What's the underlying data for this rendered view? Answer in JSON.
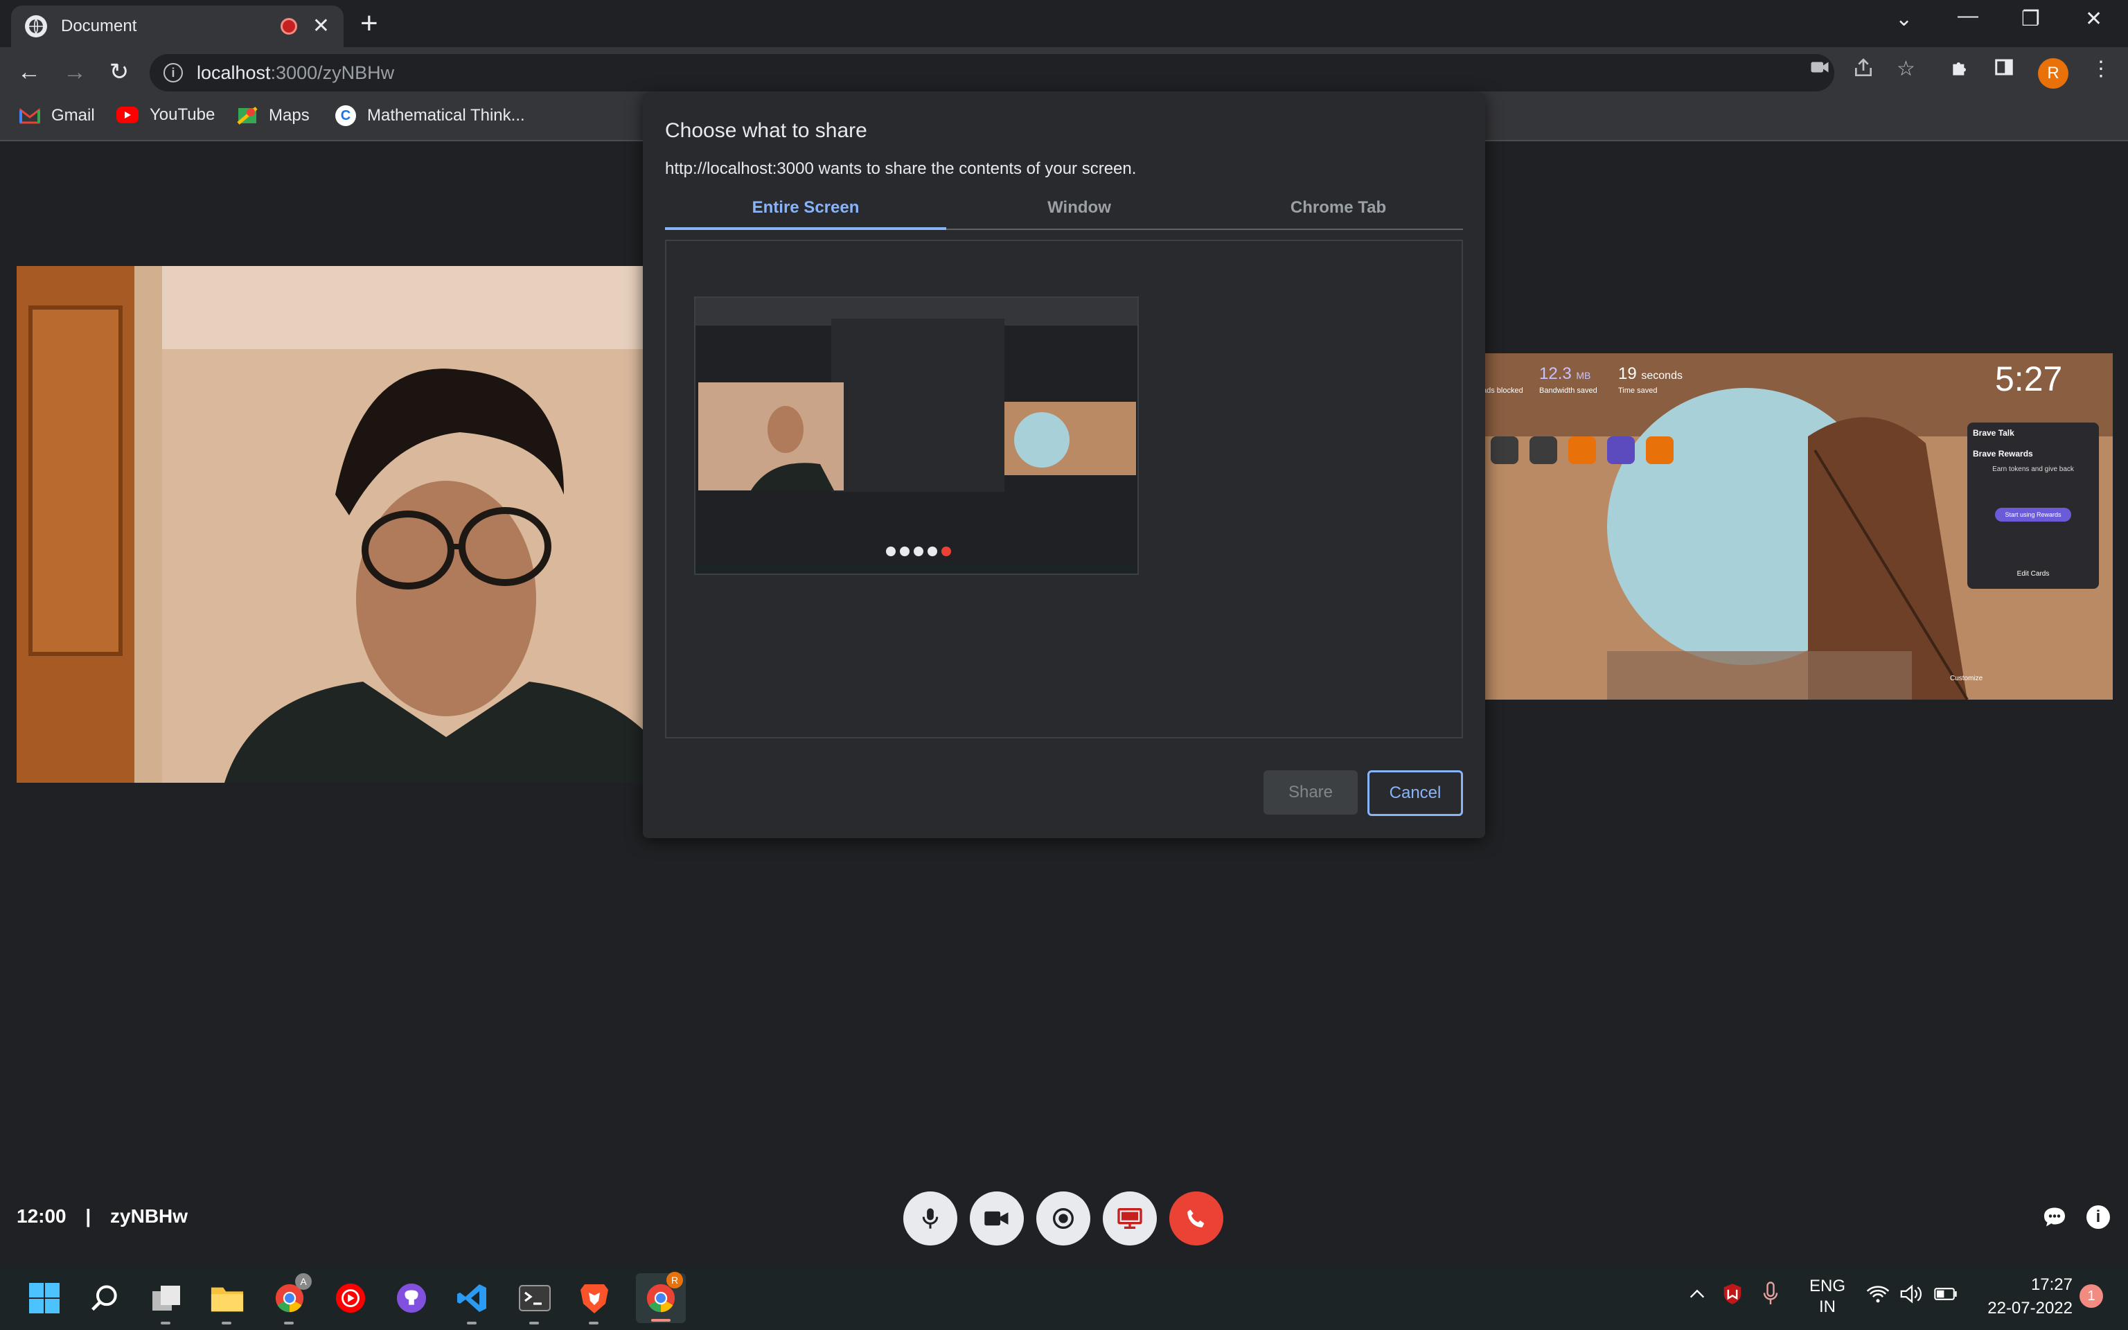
{
  "browser": {
    "tab_title": "Document",
    "url_host": "localhost",
    "url_path": ":3000/zyNBHw",
    "avatar_letter": "R",
    "bookmarks": [
      {
        "label": "Gmail",
        "color": "#ea4335"
      },
      {
        "label": "YouTube",
        "color": "#ff0000"
      },
      {
        "label": "Maps",
        "color": "#34a853"
      },
      {
        "label": "Mathematical Think...",
        "color": "#1a73e8"
      }
    ]
  },
  "dialog": {
    "title": "Choose what to share",
    "subtitle": "http://localhost:3000 wants to share the contents of your screen.",
    "tabs": [
      "Entire Screen",
      "Window",
      "Chrome Tab"
    ],
    "active_tab": "Entire Screen",
    "share_label": "Share",
    "cancel_label": "Cancel"
  },
  "remote_screen": {
    "ads_blocked_label": "ads blocked",
    "bandwidth_value": "12.3",
    "bandwidth_unit": "MB",
    "bandwidth_label": "Bandwidth saved",
    "time_value": "19",
    "time_unit": "seconds",
    "time_label": "Time saved",
    "clock": "5:27",
    "card_header": "Brave Talk",
    "card_title": "Brave Rewards",
    "card_sub": "Earn tokens and give back",
    "card_button": "Start using Rewards",
    "edit_cards": "Edit Cards",
    "customize": "Customize"
  },
  "meeting": {
    "time": "12:00",
    "separator": "|",
    "code": "zyNBHw"
  },
  "taskbar": {
    "lang_line1": "ENG",
    "lang_line2": "IN",
    "time": "17:27",
    "date": "22-07-2022",
    "notification_count": "1",
    "chrome_badge": "A",
    "chrome2_badge": "R"
  },
  "colors": {
    "accent": "#8ab4f8",
    "danger": "#ea4335",
    "dialog_bg": "#292a2d"
  }
}
